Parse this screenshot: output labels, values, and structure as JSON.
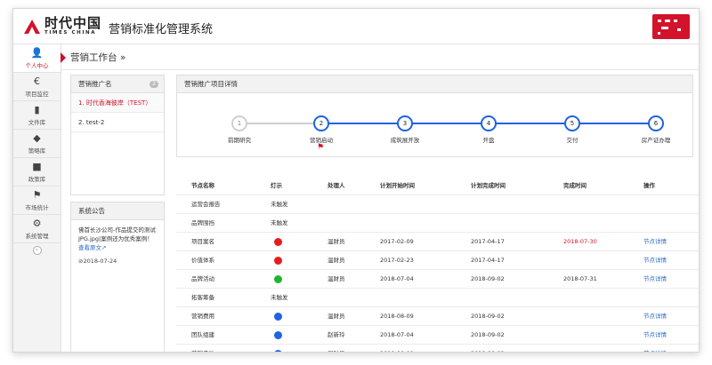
{
  "header": {
    "logo_cn": "时代中国",
    "logo_en": "TIMES CHINA",
    "app_title": "营销标准化管理系统"
  },
  "nav": [
    {
      "label": "个人中心",
      "icon": "user-icon",
      "glyph": "👤",
      "active": true
    },
    {
      "label": "项目监控",
      "icon": "euro-icon",
      "glyph": "€",
      "active": false
    },
    {
      "label": "文件库",
      "icon": "file-icon",
      "glyph": "▮",
      "active": false
    },
    {
      "label": "策略库",
      "icon": "tags-icon",
      "glyph": "◆",
      "active": false
    },
    {
      "label": "政策库",
      "icon": "book-icon",
      "glyph": "■",
      "active": false
    },
    {
      "label": "市场统计",
      "icon": "flag-icon",
      "glyph": "⚑",
      "active": false
    },
    {
      "label": "系统管理",
      "icon": "gear-icon",
      "glyph": "⚙",
      "active": false
    }
  ],
  "breadcrumb": "营销工作台 »",
  "promo": {
    "title": "营销推广名",
    "count": "2",
    "items": [
      "1. 时代香海彼岸（TEST）",
      "2. test-2"
    ]
  },
  "notice": {
    "title": "系统公告",
    "text": "佛首长沙公司-作品提交的测试JPG.jpg|案例还为优秀案例！",
    "more": "查看原文",
    "date": "⊘2018-07-24"
  },
  "detail": {
    "title": "营销推广项目详情",
    "steps": [
      {
        "num": "1",
        "label": "前期研究",
        "done": false
      },
      {
        "num": "2",
        "label": "营销启动",
        "done": true
      },
      {
        "num": "3",
        "label": "成筑展开放",
        "done": true
      },
      {
        "num": "4",
        "label": "开盘",
        "done": true
      },
      {
        "num": "5",
        "label": "交付",
        "done": true
      },
      {
        "num": "6",
        "label": "房产证办理",
        "done": true
      }
    ],
    "current_step": 2
  },
  "table": {
    "headers": [
      "节点名称",
      "灯示",
      "处理人",
      "计划开始时间",
      "计划完成时间",
      "完成时间",
      "操作"
    ],
    "rows": [
      {
        "name": "运营会报告",
        "light": "",
        "status": "未触发",
        "owner": "",
        "start": "",
        "plan_end": "",
        "done": "",
        "op": ""
      },
      {
        "name": "品牌围挡",
        "light": "",
        "status": "未触发",
        "owner": "",
        "start": "",
        "plan_end": "",
        "done": "",
        "op": ""
      },
      {
        "name": "项目案名",
        "light": "#e81c1c",
        "status": "",
        "owner": "温财员",
        "start": "2017-02-09",
        "plan_end": "2017-04-17",
        "done": "2018-07-30",
        "done_red": true,
        "op": "节点详情"
      },
      {
        "name": "价值体系",
        "light": "#e81c1c",
        "status": "",
        "owner": "温财员",
        "start": "2017-02-23",
        "plan_end": "2017-04-17",
        "done": "",
        "op": "节点详情"
      },
      {
        "name": "品牌活动",
        "light": "#1fb52e",
        "status": "",
        "owner": "温财员",
        "start": "2018-07-04",
        "plan_end": "2018-09-02",
        "done": "2018-07-31",
        "op": "节点详情"
      },
      {
        "name": "拓客筹备",
        "light": "",
        "status": "未触发",
        "owner": "",
        "start": "",
        "plan_end": "",
        "done": "",
        "op": ""
      },
      {
        "name": "营销费用",
        "light": "#1f63e0",
        "status": "",
        "owner": "温财员",
        "start": "2018-08-09",
        "plan_end": "2018-09-02",
        "done": "",
        "op": "节点详情"
      },
      {
        "name": "团队组建",
        "light": "#1f63e0",
        "status": "",
        "owner": "赵新玲",
        "start": "2018-07-04",
        "plan_end": "2018-09-02",
        "done": "",
        "op": "节点详情"
      },
      {
        "name": "营销启动",
        "light": "#1f63e0",
        "status": "",
        "owner": "温财员",
        "start": "2018-08-09",
        "plan_end": "2018-09-02",
        "done": "",
        "op": "节点详情"
      }
    ]
  },
  "colors": {
    "brand_red": "#d3132b",
    "step_blue": "#1f63e0"
  }
}
